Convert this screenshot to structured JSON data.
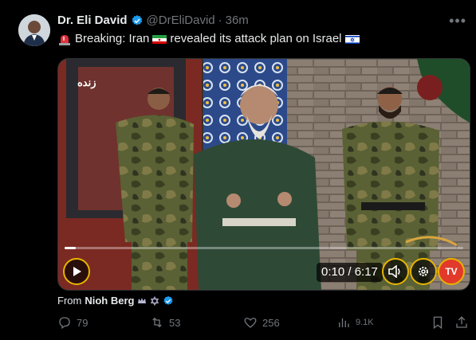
{
  "author": {
    "name": "Dr. Eli David",
    "handle": "@DrEliDavid",
    "separator": "·",
    "time": "36m"
  },
  "tweet": {
    "text_part1": "Breaking: Iran",
    "text_part2": "revealed its attack plan on Israel"
  },
  "video": {
    "time": "0:10 / 6:17",
    "progress": 0.027,
    "channel_badge": "TV",
    "live_text": "زنده"
  },
  "source": {
    "label": "From",
    "name": "Nioh Berg"
  },
  "actions": {
    "replies": "79",
    "reposts": "53",
    "likes": "256",
    "views": "9.1K"
  },
  "colors": {
    "verified": "#1d9bf0",
    "muted": "#71767b",
    "control_ring": "#e7b400"
  }
}
